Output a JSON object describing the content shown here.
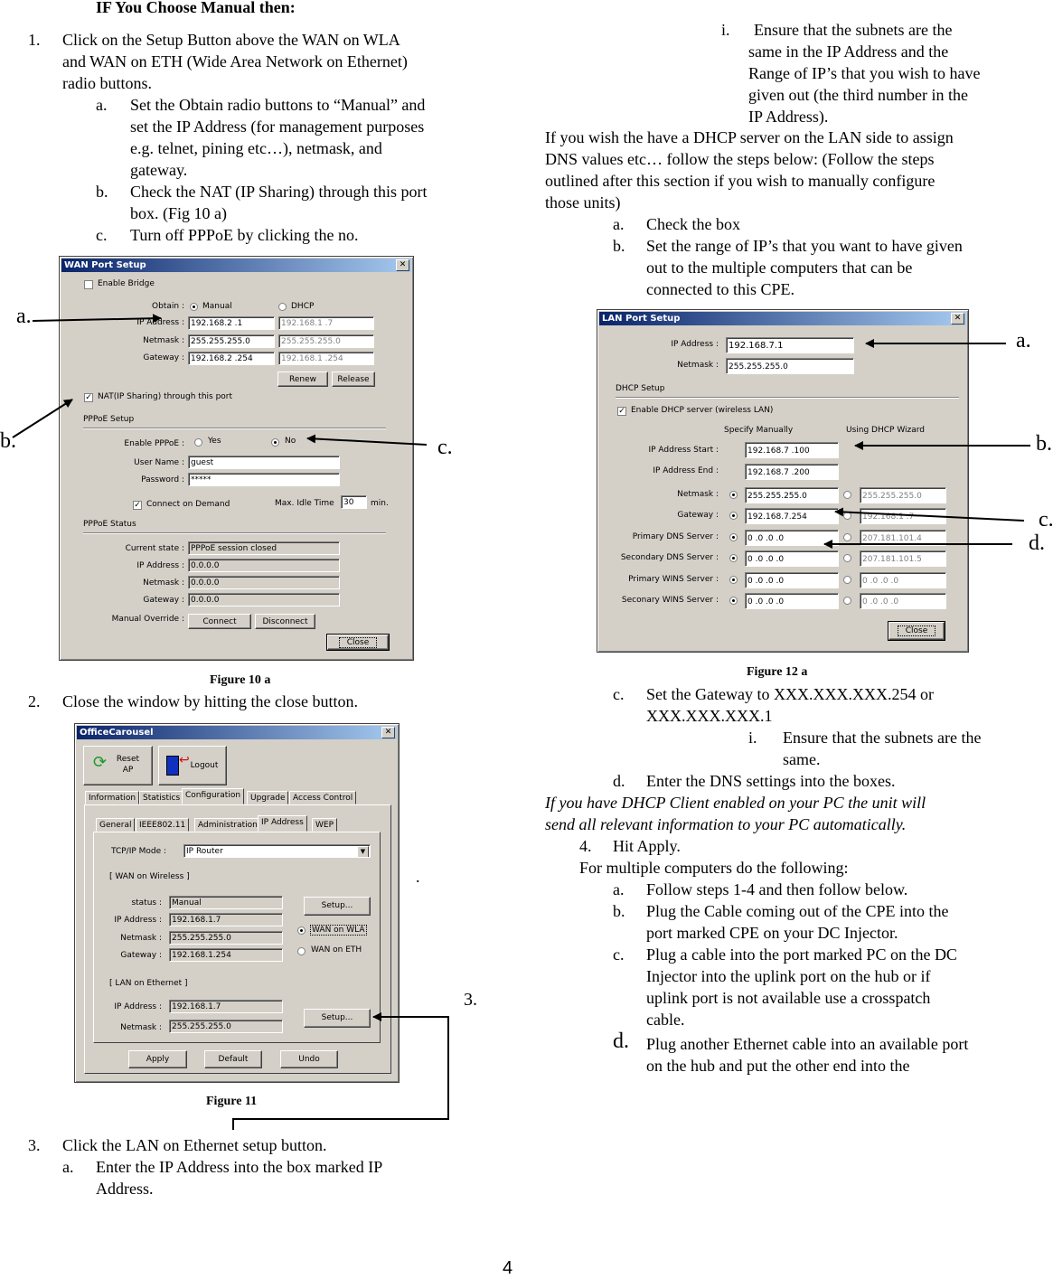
{
  "page_number": "4",
  "left_column": {
    "heading": "IF You Choose Manual then:",
    "step1": {
      "num": "1.",
      "lines": [
        "Click on the Setup Button above the WAN on WLA",
        "and WAN on ETH (Wide Area Network on Ethernet)",
        "radio buttons."
      ],
      "sub": [
        {
          "label": "a.",
          "lines": [
            "Set the Obtain radio buttons to “Manual” and",
            "set the IP Address (for management purposes",
            "e.g. telnet, pining etc…), netmask, and",
            "gateway."
          ]
        },
        {
          "label": "b.",
          "lines": [
            "Check the NAT (IP Sharing) through this port",
            "box. (Fig 10 a)"
          ]
        },
        {
          "label": "c.",
          "lines": [
            "Turn off PPPoE by clicking the no."
          ]
        }
      ]
    },
    "figure10_caption": "Figure 10 a",
    "step2": {
      "num": "2.",
      "text": "Close the window by hitting the close button."
    },
    "figure11_caption": "Figure 11",
    "stray_dot": ".",
    "callout3": "3.",
    "step3": {
      "num": "3.",
      "text": "Click the LAN on Ethernet setup button.",
      "sub": [
        {
          "label": "a.",
          "lines": [
            "Enter the IP Address into the box marked IP",
            "Address."
          ]
        }
      ]
    }
  },
  "wan_dialog": {
    "title": "WAN Port Setup",
    "enable_bridge": {
      "label": "Enable Bridge",
      "checked": false
    },
    "obtain_label": "Obtain :",
    "obtain_manual": "Manual",
    "obtain_dhcp": "DHCP",
    "fields": [
      {
        "label": "IP Address :",
        "manual": "192.168.2  .1",
        "dhcp": "192.168.1  .7"
      },
      {
        "label": "Netmask :",
        "manual": "255.255.255.0",
        "dhcp": "255.255.255.0"
      },
      {
        "label": "Gateway :",
        "manual": "192.168.2  .254",
        "dhcp": "192.168.1  .254"
      }
    ],
    "renew": "Renew",
    "release": "Release",
    "nat": {
      "label": "NAT(IP Sharing) through this port",
      "checked": true
    },
    "pppoe_setup_title": "PPPoE Setup",
    "enable_pppoe_label": "Enable PPPoE :",
    "pppoe_yes": "Yes",
    "pppoe_no": "No",
    "username_label": "User Name :",
    "username_value": "guest",
    "password_label": "Password :",
    "password_value": "*****",
    "connect_on_demand": {
      "label": "Connect on Demand",
      "checked": true
    },
    "max_idle_label": "Max. Idle Time",
    "max_idle_value": "30",
    "max_idle_unit": "min.",
    "pppoe_status_title": "PPPoE Status",
    "status_rows": [
      {
        "label": "Current state :",
        "value": "PPPoE session closed"
      },
      {
        "label": "IP Address :",
        "value": "0.0.0.0"
      },
      {
        "label": "Netmask :",
        "value": "0.0.0.0"
      },
      {
        "label": "Gateway :",
        "value": "0.0.0.0"
      }
    ],
    "manual_override_label": "Manual Override :",
    "connect": "Connect",
    "disconnect": "Disconnect",
    "close": "Close",
    "callouts": {
      "a": "a.",
      "b": "b.",
      "c": "c."
    }
  },
  "office_dialog": {
    "title": "OfficeCarousel",
    "reset_ap": [
      "Reset",
      "AP"
    ],
    "logout": "Logout",
    "tabs": [
      "Information",
      "Statistics",
      "Configuration",
      "Upgrade",
      "Access Control"
    ],
    "active_tab": "Configuration",
    "subtabs": [
      "General",
      "IEEE802.11",
      "Administration",
      "IP Address",
      "WEP"
    ],
    "active_subtab": "IP Address",
    "tcpip_label": "TCP/IP Mode :",
    "tcpip_value": "IP Router",
    "wan_wireless_title": "[ WAN on Wireless ]",
    "wan_rows": [
      {
        "label": "status :",
        "value": "Manual"
      },
      {
        "label": "IP Address :",
        "value": "192.168.1.7"
      },
      {
        "label": "Netmask :",
        "value": "255.255.255.0"
      },
      {
        "label": "Gateway :",
        "value": "192.168.1.254"
      }
    ],
    "setup": "Setup...",
    "wan_on_wla": "WAN on WLA",
    "wan_on_eth": "WAN on ETH",
    "lan_eth_title": "[ LAN on Ethernet ]",
    "lan_rows": [
      {
        "label": "IP Address :",
        "value": "192.168.1.7"
      },
      {
        "label": "Netmask :",
        "value": "255.255.255.0"
      }
    ],
    "apply": "Apply",
    "default": "Default",
    "undo": "Undo"
  },
  "right_column": {
    "sub_i": {
      "label": "i.",
      "lines": [
        "Ensure that the subnets are the",
        "same in the IP Address and the",
        "Range of IP’s that you wish to have",
        "given out (the third number in the",
        "IP Address)."
      ]
    },
    "dhcp_para": [
      "If you wish the have a DHCP server on the LAN side to assign",
      "DNS values etc…  follow the steps below: (Follow the steps",
      "outlined after this section if you wish to manually configure",
      "those units)"
    ],
    "dhcp_steps": [
      {
        "label": "a.",
        "lines": [
          "Check the box"
        ]
      },
      {
        "label": "b.",
        "lines": [
          "Set the range of IP’s that you want to have given",
          "out to the multiple computers that can be",
          "connected to this CPE."
        ]
      }
    ],
    "figure12_caption": "Figure 12 a",
    "step_c": {
      "label": "c.",
      "lines": [
        "Set the Gateway to XXX.XXX.XXX.254 or",
        "XXX.XXX.XXX.1"
      ]
    },
    "step_c_i": {
      "label": "i.",
      "lines": [
        "Ensure that the subnets are the",
        "same."
      ]
    },
    "step_d": {
      "label": "d.",
      "text": "Enter the DNS settings into the boxes."
    },
    "italic_note": [
      "If you have DHCP Client enabled on your PC the unit will",
      "send all relevant information to your PC automatically."
    ],
    "step4": {
      "num": "4.",
      "text": "Hit Apply."
    },
    "multi_heading": "For multiple computers do the following:",
    "multi_steps": [
      {
        "label": "a.",
        "lines": [
          "Follow steps 1-4 and then follow below."
        ]
      },
      {
        "label": "b.",
        "lines": [
          "Plug the Cable coming out of the CPE into the",
          "port marked CPE on your DC Injector."
        ]
      },
      {
        "label": "c.",
        "lines": [
          "Plug a cable into the port marked PC on the DC",
          "Injector into the uplink port on the hub or if",
          "uplink port is not available use a crosspatch",
          "cable."
        ]
      },
      {
        "label": "d.",
        "lines": [
          "Plug another Ethernet cable into an available port",
          "on the hub and put the other end into the"
        ]
      }
    ]
  },
  "lan_dialog": {
    "title": "LAN Port Setup",
    "ip_label": "IP Address :",
    "ip_value": "192.168.7.1",
    "netmask_label": "Netmask :",
    "netmask_value": "255.255.255.0",
    "dhcp_setup_title": "DHCP Setup",
    "enable_dhcp": {
      "label": "Enable DHCP server (wireless LAN)",
      "checked": true
    },
    "col_manual": "Specify Manually",
    "col_wizard": "Using DHCP Wizard",
    "range_rows": [
      {
        "label": "IP Address Start :",
        "value": "192.168.7  .100"
      },
      {
        "label": "IP Address End :",
        "value": "192.168.7  .200"
      }
    ],
    "rows": [
      {
        "label": "Netmask :",
        "manual": "255.255.255.0",
        "wizard": "255.255.255.0"
      },
      {
        "label": "Gateway :",
        "manual": "192.168.7.254",
        "wizard": "192.168.1  .7"
      },
      {
        "label": "Primary DNS Server :",
        "manual": "0  .0  .0  .0",
        "wizard": "207.181.101.4"
      },
      {
        "label": "Secondary DNS Server :",
        "manual": "0  .0  .0  .0",
        "wizard": "207.181.101.5"
      },
      {
        "label": "Primary WINS Server :",
        "manual": "0  .0  .0  .0",
        "wizard": "0  .0  .0  .0"
      },
      {
        "label": "Seconary WINS Server :",
        "manual": "0  .0  .0  .0",
        "wizard": "0  .0  .0  .0"
      }
    ],
    "close": "Close",
    "callouts": {
      "a": "a.",
      "b": "b.",
      "c": "c.",
      "d": "d."
    }
  }
}
